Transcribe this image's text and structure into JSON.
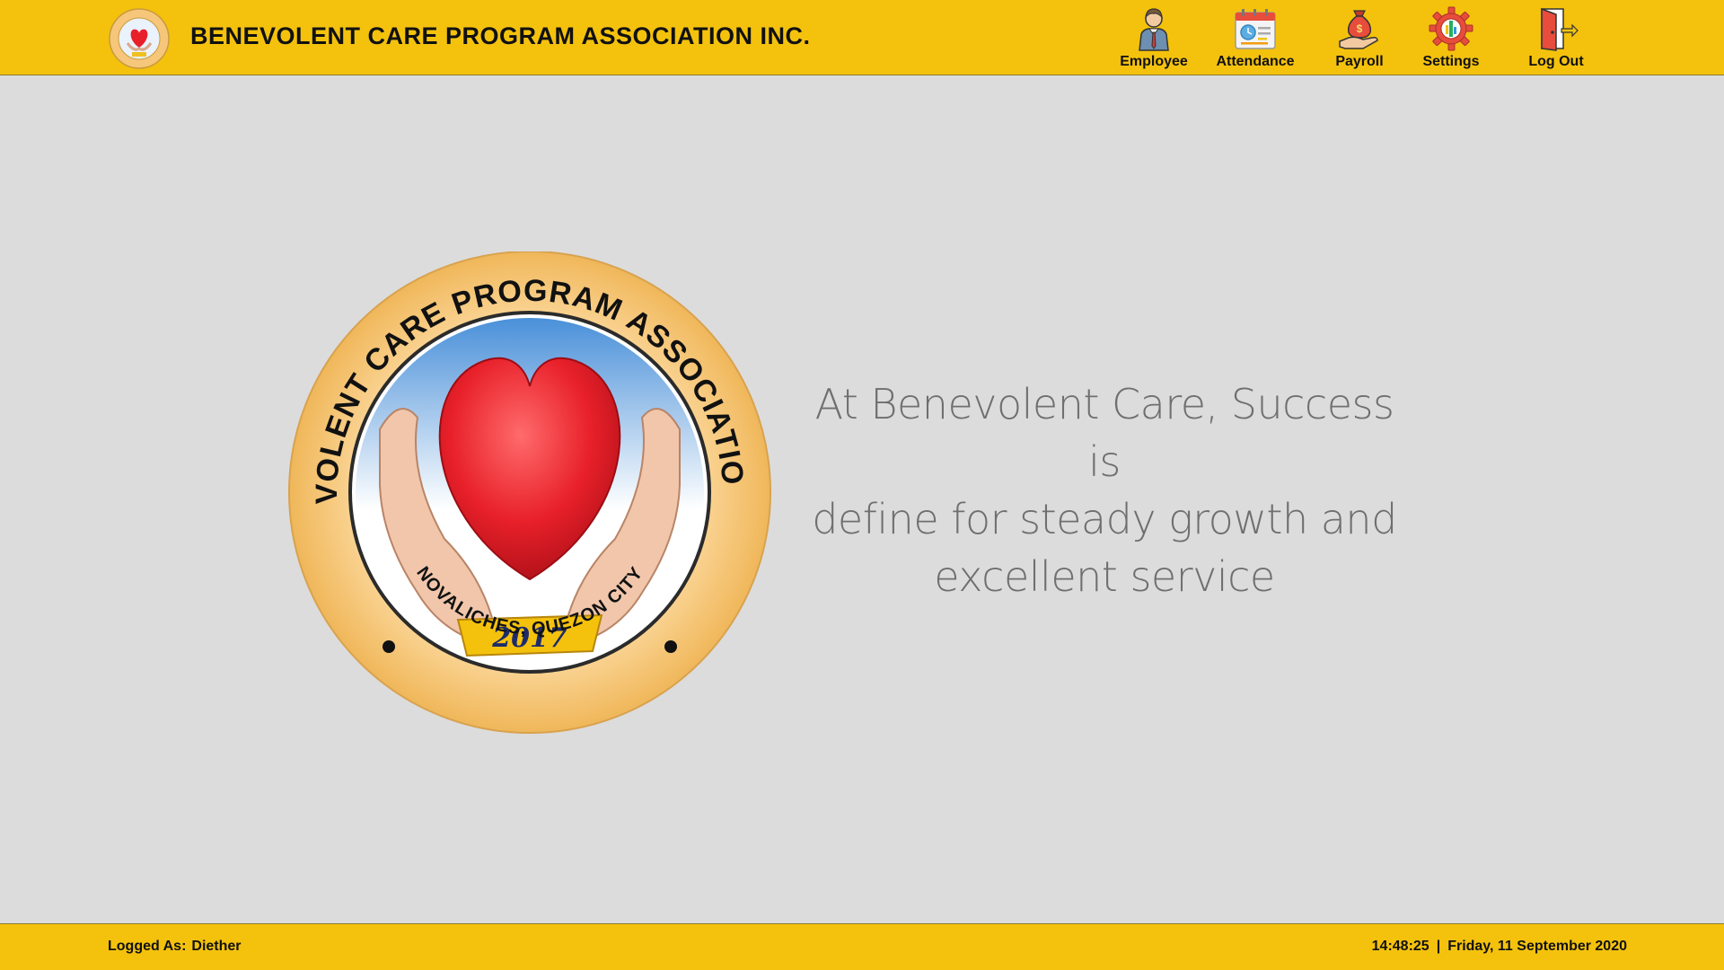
{
  "header": {
    "title": "BENEVOLENT CARE PROGRAM ASSOCIATION INC.",
    "logo_icon": "association-logo-icon"
  },
  "nav": {
    "items": [
      {
        "label": "Employee",
        "icon": "employee-icon"
      },
      {
        "label": "Attendance",
        "icon": "calendar-icon"
      },
      {
        "label": "Payroll",
        "icon": "money-bag-hand-icon"
      },
      {
        "label": "Settings",
        "icon": "gear-icon"
      },
      {
        "label": "Log Out",
        "icon": "exit-door-icon"
      }
    ]
  },
  "emblem": {
    "top_text": "BENEVOLENT CARE PROGRAM ASSOCIATION, INC.",
    "bottom_text": "NOVALICHES, QUEZON CITY",
    "year": "2017"
  },
  "main": {
    "tagline_line1": "At Benevolent Care, Success is",
    "tagline_line2": "define for steady growth and",
    "tagline_line3": "excellent service"
  },
  "footer": {
    "logged_label": "Logged As:",
    "user": "Diether",
    "time": "14:48:25",
    "separator": "|",
    "date": "Friday, 11 September 2020"
  },
  "colors": {
    "bar": "#f4c20d",
    "background": "#dcdcdc",
    "tagline": "#6f6f6f",
    "heart": "#e8202a",
    "emblem_ring": "#f6c77a"
  }
}
